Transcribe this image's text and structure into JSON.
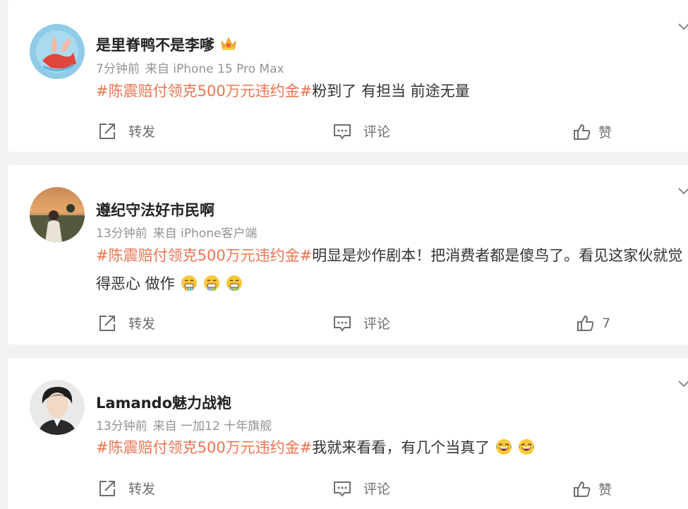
{
  "posts": [
    {
      "user": "是里脊鸭不是李嗲",
      "time": "7分钟前",
      "source": "来自 iPhone 15 Pro Max",
      "hashtag": "#陈震赔付领克500万元违约金#",
      "text": "粉到了 有担当 前途无量",
      "repost": "转发",
      "comment": "评论",
      "like": "赞"
    },
    {
      "user": "遵纪守法好市民啊",
      "time": "13分钟前",
      "source": "来自 iPhone客户端",
      "hashtag": "#陈震赔付领克500万元违约金#",
      "text": "明显是炒作剧本！把消费者都是傻鸟了。看见这家伙就觉得恶心 做作",
      "repost": "转发",
      "comment": "评论",
      "like": "7"
    },
    {
      "user": "Lamando魅力战袍",
      "time": "13分钟前",
      "source": "来自 一加12 十年旗舰",
      "hashtag": "#陈震赔付领克500万元违约金#",
      "text": "我就来看看，有几个当真了",
      "repost": "转发",
      "comment": "评论",
      "like": "赞"
    }
  ],
  "colors": {
    "hashtag": "#eb7350",
    "name": "#222222",
    "meta": "#939393",
    "action": "#6e6e6e",
    "background": "#f2f2f2"
  },
  "icons": {
    "badge": "crown-badge-icon",
    "repost": "repost-icon",
    "comment": "comment-icon",
    "like": "thumbs-up-icon",
    "menu": "chevron-down-icon",
    "emoji_post2": "drooling-face-emoji",
    "emoji_post3": "laughing-tears-emoji"
  }
}
